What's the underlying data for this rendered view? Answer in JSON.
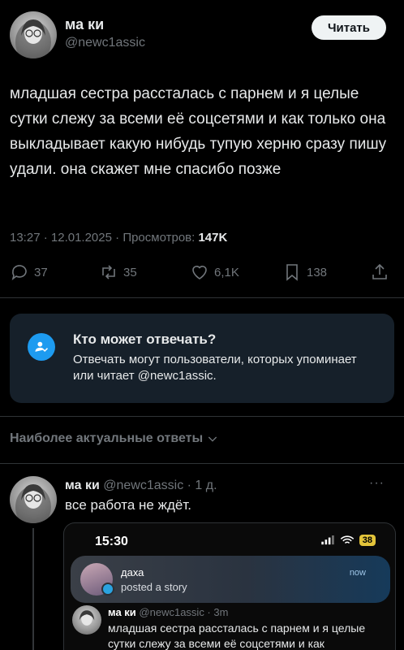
{
  "tweet": {
    "author_name": "ма ки",
    "author_handle": "@newc1assic",
    "follow_label": "Читать",
    "text": "младшая сестра рассталась с парнем и я целые сутки слежу за всеми её соцсетями и как только она выкладывает какую нибудь тупую херню сразу пишу удали. она скажет мне спасибо позже",
    "time": "13:27",
    "date": "12.01.2025",
    "views_label": "Просмотров:",
    "views_count": "147K"
  },
  "actions": {
    "replies": "37",
    "reposts": "35",
    "likes": "6,1K",
    "bookmarks": "138"
  },
  "reply_card": {
    "title": "Кто может отвечать?",
    "body": "Отвечать могут пользователи, которых упоминает или читает @newc1assic."
  },
  "relevant_label": "Наиболее актуальные ответы",
  "reply": {
    "author_name": "ма ки",
    "handle_time": "@newc1assic · 1 д.",
    "text": "все работа не ждёт.",
    "more": "···"
  },
  "screenshot": {
    "time": "15:30",
    "battery": "38",
    "notification": {
      "name": "даха",
      "subtitle": "posted a story",
      "when": "now"
    },
    "inner_tweet": {
      "author_name": "ма ки",
      "handle_time": "@newc1assic · 3m",
      "text": "младшая сестра рассталась с парнем и я целые сутки слежу за всеми её соцсетями и как"
    }
  },
  "colors": {
    "accent": "#1d9bf0",
    "muted": "#71767b",
    "card_bg": "#16202a"
  }
}
